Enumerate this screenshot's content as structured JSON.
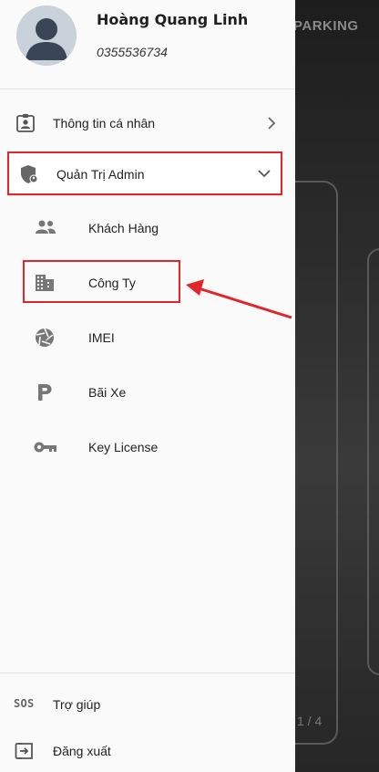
{
  "background": {
    "brand_text": "PARKING",
    "page_indicator": "1 / 4"
  },
  "profile": {
    "name": "Hoàng Quang Linh",
    "phone": "0355536734"
  },
  "menu": {
    "personal_info": {
      "label": "Thông tin cá nhân",
      "icon": "id-badge-icon"
    },
    "admin": {
      "label": "Quản Trị Admin",
      "icon": "admin-shield-icon",
      "expanded": true
    },
    "admin_items": [
      {
        "label": "Khách Hàng",
        "icon": "customers-icon"
      },
      {
        "label": "Công Ty",
        "icon": "company-building-icon"
      },
      {
        "label": "IMEI",
        "icon": "aperture-icon"
      },
      {
        "label": "Bãi Xe",
        "icon": "parking-icon"
      },
      {
        "label": "Key License",
        "icon": "key-icon"
      }
    ],
    "help": {
      "label": "Trợ giúp",
      "icon": "sos-icon",
      "icon_text": "SOS"
    },
    "logout": {
      "label": "Đăng xuất",
      "icon": "logout-icon"
    }
  },
  "annotation": {
    "highlight_color": "#e0262b"
  }
}
